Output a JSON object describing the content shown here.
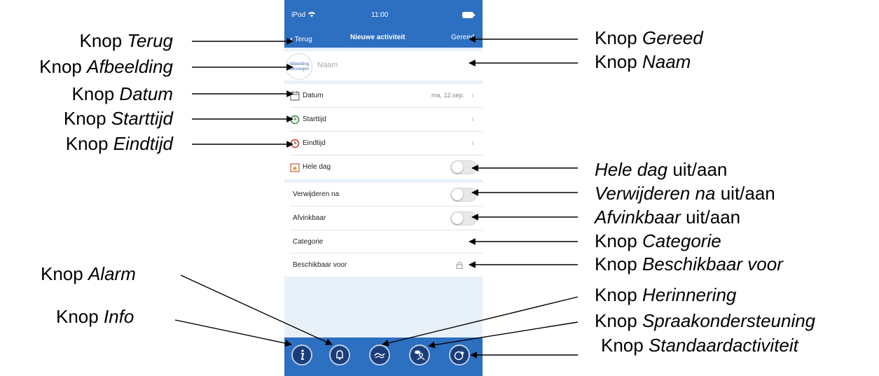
{
  "status_bar": {
    "device": "iPod",
    "time": "11:00"
  },
  "nav": {
    "back_label": "Terug",
    "title": "Nieuwe activiteit",
    "done_label": "Gereed"
  },
  "name_row": {
    "avatar_text_1": "Afbeelding",
    "avatar_text_2": "toevoegen",
    "placeholder": "Naam"
  },
  "rows": [
    {
      "label": "Datum",
      "value": "ma, 12.sep.",
      "icon": "calendar-icon"
    },
    {
      "label": "Starttijd",
      "icon": "clock-start-icon"
    },
    {
      "label": "Eindtijd",
      "icon": "clock-end-icon"
    },
    {
      "label": "Hele dag",
      "icon": "calendar-day-icon",
      "toggle": "off"
    }
  ],
  "options": [
    {
      "label": "Verwijderen na",
      "toggle": "off"
    },
    {
      "label": "Afvinkbaar",
      "toggle": "off"
    },
    {
      "label": "Categorie"
    },
    {
      "label": "Beschikbaar voor",
      "icon": "lock-icon"
    }
  ],
  "toolbar": [
    "info-icon",
    "alarm-bell-icon",
    "reminder-icon",
    "speech-icon",
    "standard-activity-icon"
  ],
  "annotations": {
    "terug": {
      "knop": "Knop",
      "name": "Terug"
    },
    "afbeelding": {
      "knop": "Knop",
      "name": "Afbeelding"
    },
    "datum": {
      "knop": "Knop",
      "name": "Datum"
    },
    "starttijd": {
      "knop": "Knop",
      "name": "Starttijd"
    },
    "eindtijd": {
      "knop": "Knop",
      "name": "Eindtijd"
    },
    "alarm": {
      "knop": "Knop",
      "name": "Alarm"
    },
    "info": {
      "knop": "Knop",
      "name": "Info"
    },
    "gereed": {
      "knop": "Knop",
      "name": "Gereed"
    },
    "naam": {
      "knop": "Knop",
      "name": "Naam"
    },
    "hele_dag": {
      "name": "Hele dag",
      "suffix": "uit/aan"
    },
    "verwijderen": {
      "name": "Verwijderen na",
      "suffix": "uit/aan"
    },
    "afvinkbaar": {
      "name": "Afvinkbaar",
      "suffix": "uit/aan"
    },
    "categorie": {
      "knop": "Knop",
      "name": "Categorie"
    },
    "beschikbaar": {
      "knop": "Knop",
      "name": "Beschikbaar voor"
    },
    "herinnering": {
      "knop": "Knop",
      "name": "Herinnering"
    },
    "spraak": {
      "knop": "Knop",
      "name": "Spraakondersteuning"
    },
    "standaard": {
      "knop": "Knop",
      "name": "Standaardactiviteit"
    }
  },
  "colors": {
    "brand_blue": "#2d6fc0",
    "button_dark": "#1a3e7a",
    "background": "#e8f0f8"
  }
}
